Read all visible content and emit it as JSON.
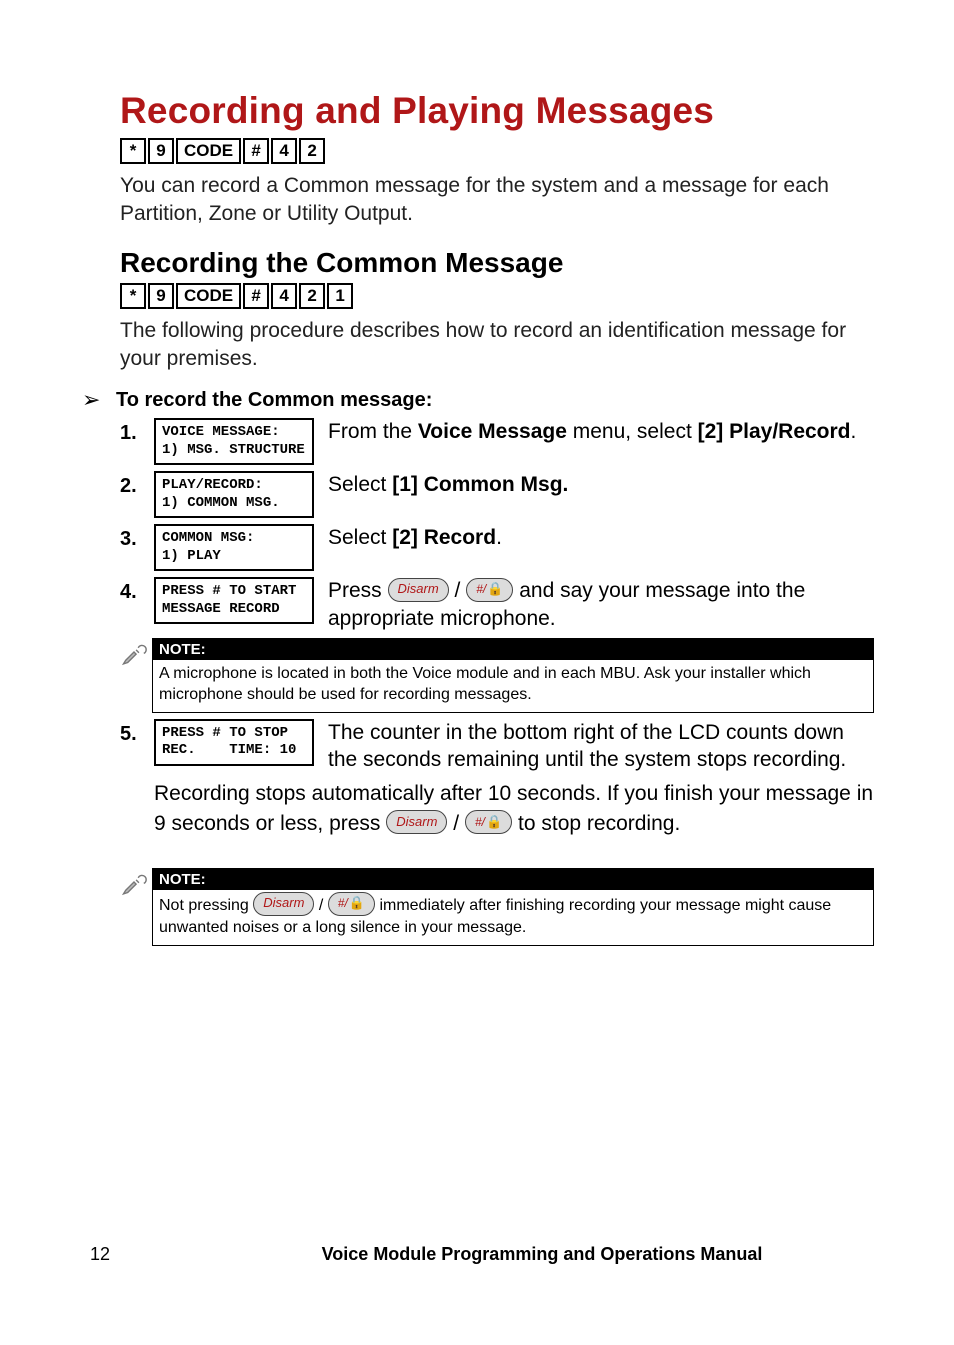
{
  "h1": "Recording and Playing Messages",
  "keyseq1": [
    "*",
    "9",
    "CODE",
    "#",
    "4",
    "2"
  ],
  "intro": "You can record a Common message for the system and a message for each Partition, Zone or Utility Output.",
  "h2": "Recording the Common Message",
  "keyseq2": [
    "*",
    "9",
    "CODE",
    "#",
    "4",
    "2",
    "1"
  ],
  "intro2": "The following procedure describes how to record an identification message for your premises.",
  "procTitle": "To record the Common message:",
  "steps": [
    {
      "num": "1.",
      "lcd": "VOICE MESSAGE:\n1) MSG. STRUCTURE",
      "text_pre": "From the ",
      "text_b1": "Voice Message",
      "text_mid": " menu, select ",
      "text_b2": "[2] Play/Record",
      "text_post": "."
    },
    {
      "num": "2.",
      "lcd": "PLAY/RECORD:\n1) COMMON MSG.",
      "text_pre": "Select ",
      "text_b1": "[1] Common Msg.",
      "text_mid": "",
      "text_b2": "",
      "text_post": ""
    },
    {
      "num": "3.",
      "lcd": "COMMON MSG:\n1) PLAY",
      "text_pre": "Select ",
      "text_b1": "[2] Record",
      "text_mid": "",
      "text_b2": "",
      "text_post": "."
    },
    {
      "num": "4.",
      "lcd": "PRESS # TO START\nMESSAGE RECORD",
      "text_pre": "Press ",
      "text_post_buttons": " and say your message into the appropriate microphone."
    },
    {
      "num": "5.",
      "lcd": "PRESS # TO STOP\nREC.    TIME: 10",
      "text_plain": "The counter in the bottom right of the LCD counts down the seconds remaining until the system stops recording."
    }
  ],
  "note1": {
    "title": "NOTE:",
    "body": "A microphone is located in both the Voice module and in each MBU. Ask your installer which microphone should be used for recording messages."
  },
  "cont_pre": "Recording stops automatically after 10 seconds. If you finish your message in 9 seconds or less, press ",
  "cont_post": " to stop recording.",
  "note2": {
    "title": "NOTE:",
    "body_pre": "Not pressing ",
    "body_post": " immediately after finishing recording your message might cause unwanted noises or a long silence in your message."
  },
  "disarm_label": "Disarm",
  "hash_label": "#/",
  "page_num": "12",
  "footer_title": "Voice Module Programming and Operations Manual"
}
